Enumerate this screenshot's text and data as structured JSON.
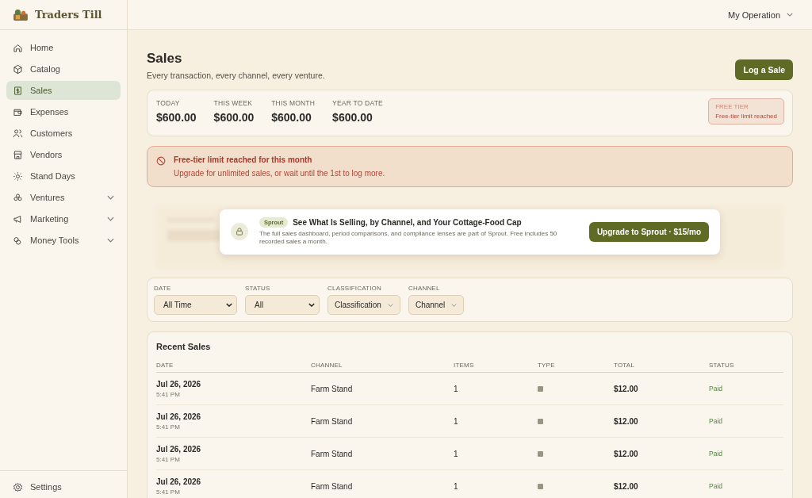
{
  "brand": {
    "name": "Traders Till"
  },
  "topbar": {
    "account": "My Operation"
  },
  "sidebar": {
    "items": [
      {
        "label": "Home",
        "selected": false,
        "kind": "link"
      },
      {
        "label": "Catalog",
        "selected": false,
        "kind": "link"
      },
      {
        "label": "Sales",
        "selected": true,
        "kind": "link"
      },
      {
        "label": "Expenses",
        "selected": false,
        "kind": "link"
      },
      {
        "label": "Customers",
        "selected": false,
        "kind": "link"
      },
      {
        "label": "Vendors",
        "selected": false,
        "kind": "link"
      },
      {
        "label": "Stand Days",
        "selected": false,
        "kind": "link"
      },
      {
        "label": "Ventures",
        "selected": false,
        "kind": "group"
      },
      {
        "label": "Marketing",
        "selected": false,
        "kind": "group"
      },
      {
        "label": "Money Tools",
        "selected": false,
        "kind": "group"
      }
    ],
    "footer": {
      "label": "Settings"
    }
  },
  "header": {
    "title": "Sales",
    "subtitle": "Every transaction, every channel, every venture.",
    "action": "Log a Sale"
  },
  "stats": [
    {
      "label": "TODAY",
      "value": "$600.00"
    },
    {
      "label": "THIS WEEK",
      "value": "$600.00"
    },
    {
      "label": "THIS MONTH",
      "value": "$600.00"
    },
    {
      "label": "YEAR TO DATE",
      "value": "$600.00"
    }
  ],
  "tier_badge": {
    "title": "FREE TIER",
    "text": "Free-tier limit reached"
  },
  "alert": {
    "title": "Free-tier limit reached for this month",
    "text": "Upgrade for unlimited sales, or wait until the 1st to log more."
  },
  "upsell": {
    "tag": "Sprout",
    "title": "See What Is Selling, by Channel, and Your Cottage-Food Cap",
    "text": "The full sales dashboard, period comparisons, and compliance lenses are part of Sprout. Free includes 50 recorded sales a month.",
    "button": "Upgrade to Sprout · $15/mo"
  },
  "filters": [
    {
      "label": "DATE",
      "value": "All Time",
      "kind": "select"
    },
    {
      "label": "STATUS",
      "value": "All",
      "kind": "select"
    },
    {
      "label": "CLASSIFICATION",
      "value": "Classification",
      "kind": "dropdown"
    },
    {
      "label": "CHANNEL",
      "value": "Channel",
      "kind": "dropdown"
    }
  ],
  "table": {
    "title": "Recent Sales",
    "columns": [
      "DATE",
      "CHANNEL",
      "ITEMS",
      "TYPE",
      "TOTAL",
      "STATUS"
    ],
    "rows": [
      {
        "date": "Jul 26, 2026",
        "time": "5:41 PM",
        "channel": "Farm Stand",
        "items": "1",
        "total": "$12.00",
        "status": "Paid"
      },
      {
        "date": "Jul 26, 2026",
        "time": "5:41 PM",
        "channel": "Farm Stand",
        "items": "1",
        "total": "$12.00",
        "status": "Paid"
      },
      {
        "date": "Jul 26, 2026",
        "time": "5:41 PM",
        "channel": "Farm Stand",
        "items": "1",
        "total": "$12.00",
        "status": "Paid"
      },
      {
        "date": "Jul 26, 2026",
        "time": "5:41 PM",
        "channel": "Farm Stand",
        "items": "1",
        "total": "$12.00",
        "status": "Paid"
      }
    ]
  }
}
